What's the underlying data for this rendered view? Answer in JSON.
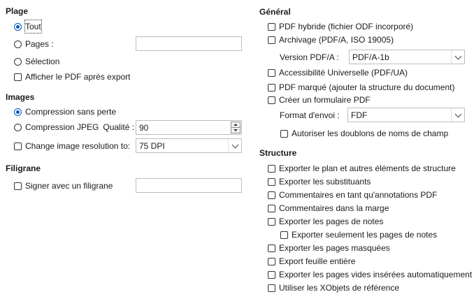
{
  "range": {
    "title": "Plage",
    "all": "Tout",
    "pages": "Pages :",
    "selection": "Sélection",
    "view_after_export": "Afficher le PDF après export",
    "pages_value": ""
  },
  "images": {
    "title": "Images",
    "lossless": "Compression sans perte",
    "jpeg": "Compression JPEG",
    "quality_label": "Qualité :",
    "quality_value": "90",
    "change_resolution": "Change image resolution to:",
    "resolution_value": "75 DPI"
  },
  "watermark": {
    "title": "Filigrane",
    "sign": "Signer avec un filigrane",
    "text_value": ""
  },
  "general": {
    "title": "Général",
    "hybrid": "PDF hybride (fichier ODF incorporé)",
    "archive": "Archivage (PDF/A, ISO 19005)",
    "pdfa_version_label": "Version PDF/A :",
    "pdfa_version_value": "PDF/A-1b",
    "universal_access": "Accessibilité Universelle (PDF/UA)",
    "tagged_pdf": "PDF marqué (ajouter la structure du document)",
    "create_form": "Créer un formulaire PDF",
    "submit_format_label": "Format d'envoi :",
    "submit_format_value": "FDF",
    "allow_duplicate_names": "Autoriser les doublons de noms de champ"
  },
  "structure": {
    "title": "Structure",
    "items": [
      "Exporter le plan et autres éléments de structure",
      "Exporter les substituants",
      "Commentaires en tant qu'annotations PDF",
      "Commentaires dans la marge",
      "Exporter les pages de notes",
      "Exporter seulement les pages de notes",
      "Exporter les pages masquées",
      "Export feuille entière",
      "Exporter les pages vides insérées automatiquement",
      "Utiliser les XObjets de référence"
    ]
  },
  "colors": {
    "accent": "#0a56b8",
    "border": "#bdbdbd"
  }
}
